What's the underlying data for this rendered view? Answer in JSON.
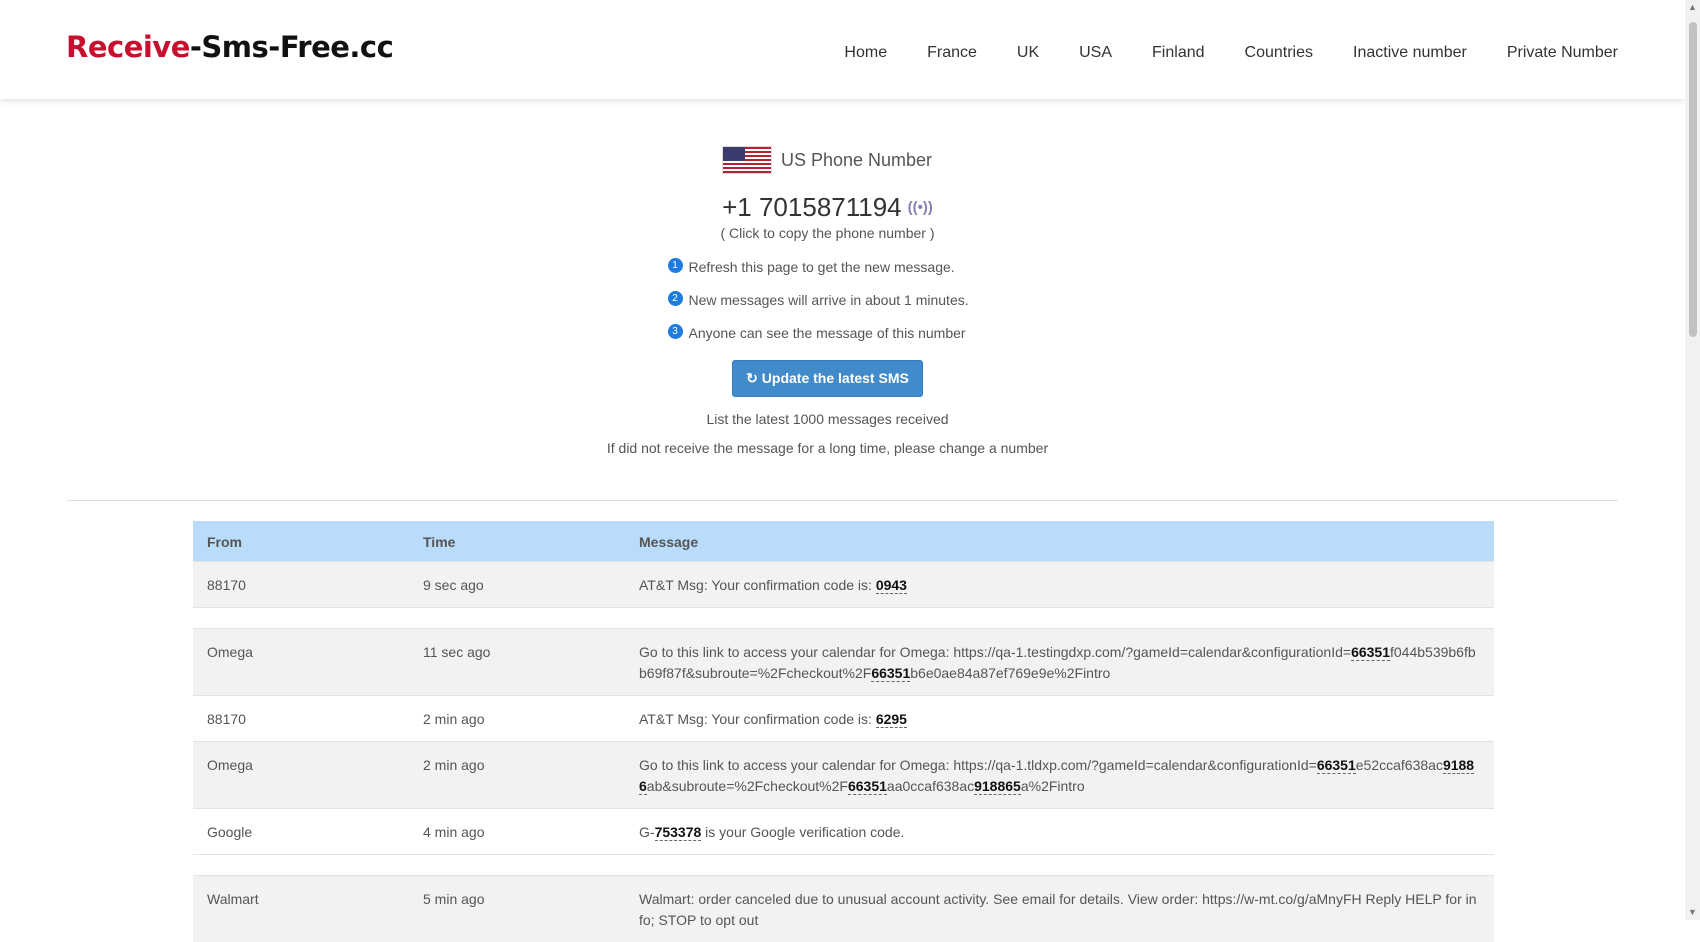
{
  "header": {
    "logo_part1": "Receive",
    "logo_part2": "-Sms-Free.cc",
    "nav": [
      "Home",
      "France",
      "UK",
      "USA",
      "Finland",
      "Countries",
      "Inactive number",
      "Private Number"
    ]
  },
  "hero": {
    "country_label": "US Phone Number",
    "flag_icon": "us-flag-icon",
    "phone_number": "+1 7015871194",
    "signal_icon_glyph": "((•))",
    "copy_hint": "( Click to copy the phone number )",
    "tips": [
      {
        "num": "1",
        "text": "Refresh this page to get the new message."
      },
      {
        "num": "2",
        "text": "New messages will arrive in about 1 minutes."
      },
      {
        "num": "3",
        "text": "Anyone can see the message of this number"
      }
    ],
    "update_button": "↻ Update the latest SMS",
    "list_note": "List the latest 1000 messages received",
    "change_note": "If did not receive the message for a long time, please change a number"
  },
  "table": {
    "headers": {
      "from": "From",
      "time": "Time",
      "message": "Message"
    },
    "rows": [
      {
        "from": "88170",
        "time": "9 sec ago",
        "shade": "grey",
        "message": [
          {
            "t": "AT&T Msg: Your confirmation code is: "
          },
          {
            "c": "0943"
          }
        ]
      },
      {
        "spacer": true
      },
      {
        "from": "Omega",
        "time": "11 sec ago",
        "shade": "grey",
        "message": [
          {
            "t": "Go to this link to access your calendar for Omega: https://qa-1.testingdxp.com/?gameId=calendar&configurationId="
          },
          {
            "c": "66351"
          },
          {
            "t": "f044b539b6fbb69f87f&subroute=%2Fcheckout%2F"
          },
          {
            "c": "66351"
          },
          {
            "t": "b6e0ae84a87ef769e9e%2Fintro"
          }
        ]
      },
      {
        "from": "88170",
        "time": "2 min ago",
        "shade": "white",
        "message": [
          {
            "t": "AT&T Msg: Your confirmation code is: "
          },
          {
            "c": "6295"
          }
        ]
      },
      {
        "from": "Omega",
        "time": "2 min ago",
        "shade": "grey",
        "message": [
          {
            "t": "Go to this link to access your calendar for Omega: https://qa-1.tldxp.com/?gameId=calendar&configurationId="
          },
          {
            "c": "66351"
          },
          {
            "t": "e52ccaf638ac"
          },
          {
            "c": "91886"
          },
          {
            "t": "ab&subroute=%2Fcheckout%2F"
          },
          {
            "c": "66351"
          },
          {
            "t": "aa0ccaf638ac"
          },
          {
            "c": "918865"
          },
          {
            "t": "a%2Fintro"
          }
        ]
      },
      {
        "from": "Google",
        "time": "4 min ago",
        "shade": "white",
        "message": [
          {
            "t": "G-"
          },
          {
            "c": "753378"
          },
          {
            "t": " is your Google verification code."
          }
        ]
      },
      {
        "spacer": true
      },
      {
        "from": "Walmart",
        "time": "5 min ago",
        "shade": "grey",
        "message": [
          {
            "t": "Walmart: order canceled due to unusual account activity. See email for details. View order: https://w-mt.co/g/aMnyFH Reply HELP for info; STOP to opt out"
          }
        ]
      }
    ]
  },
  "colors": {
    "accent": "#428bca",
    "header_row": "#b9dcfb",
    "logo_red": "#c8102e"
  }
}
